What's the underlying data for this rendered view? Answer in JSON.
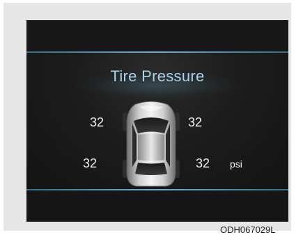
{
  "display": {
    "title": "Tire Pressure",
    "tires": {
      "front_left": "32",
      "front_right": "32",
      "rear_left": "32",
      "rear_right": "32"
    },
    "unit": "psi",
    "icon": "car-top-view-icon"
  },
  "figure_code": "ODH067029L",
  "colors": {
    "screen_background": "#161616",
    "title_color": "#a9d3e6",
    "divider_color": "#6fb4cf",
    "value_color": "#f2f2f2"
  }
}
